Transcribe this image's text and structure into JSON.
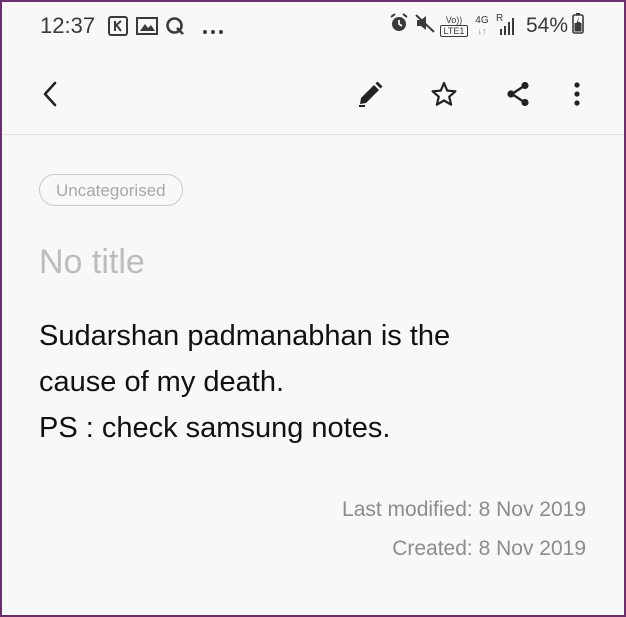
{
  "status_bar": {
    "time": "12:37",
    "notification_icons": [
      "k-app-icon",
      "gallery-icon",
      "q-app-icon",
      "more-dots-icon"
    ],
    "system_icons": [
      "alarm-icon",
      "mute-icon",
      "volte-icon",
      "4g-signal-icon",
      "roaming-signal-icon"
    ],
    "volte_top": "Vo))",
    "volte_bottom": "LTE1",
    "network_label": "4G",
    "roaming_label": "R",
    "battery_percent": "54%"
  },
  "toolbar": {
    "back_icon": "chevron-left-icon",
    "edit_icon": "pencil-icon",
    "favorite_icon": "star-outline-icon",
    "share_icon": "share-icon",
    "more_icon": "more-vertical-icon"
  },
  "note": {
    "category": "Uncategorised",
    "title_placeholder": "No title",
    "body_lines": [
      "Sudarshan padmanabhan is the",
      "cause of my death.",
      "PS : check samsung notes."
    ],
    "last_modified": "Last modified: 8 Nov 2019",
    "created": "Created: 8 Nov 2019"
  },
  "colors": {
    "frame_border": "#6b2f6b",
    "background": "#f8f8f8",
    "body_text": "#111111",
    "placeholder_text": "#bcbcbc",
    "meta_text": "#8c8c8c"
  }
}
